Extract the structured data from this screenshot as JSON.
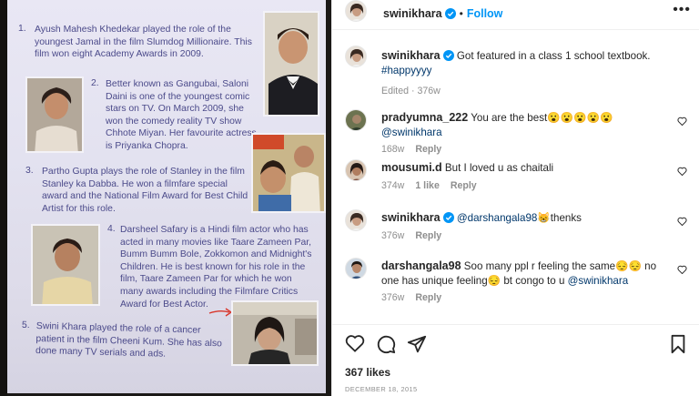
{
  "post": {
    "username": "swinikhara",
    "follow_label": "Follow",
    "caption": "Got featured in a class 1 school textbook.",
    "hashtag": "#happyyyy",
    "caption_meta": "Edited · 376w",
    "likes": "367 likes",
    "date": "DECEMBER 18, 2015"
  },
  "comments": [
    {
      "username": "pradyumna_222",
      "text": "You are the best",
      "emoji": "😮😮😮😮😮",
      "mention": "@swinikhara",
      "age": "168w",
      "likes": "",
      "reply": "Reply"
    },
    {
      "username": "mousumi.d",
      "text": "But I loved u as chaitali",
      "age": "374w",
      "likes": "1 like",
      "reply": "Reply"
    },
    {
      "username": "swinikhara",
      "mention": "@darshangala98",
      "emoji": "😸",
      "text": "thenks",
      "age": "376w",
      "reply": "Reply"
    },
    {
      "username": "darshangala98",
      "text_a": "Soo many ppl r feeling the same",
      "emoji_a": "😔😔",
      "text_b": "no one has unique feeling",
      "emoji_b": "😔",
      "text_c": "bt congo to u",
      "mention": "@swinikhara",
      "age": "376w",
      "reply": "Reply"
    }
  ],
  "textbook": {
    "item1_num": "1.",
    "item1": "Ayush Mahesh Khedekar played the role of the youngest Jamal in the film Slumdog Millionaire. This film won eight Academy Awards in 2009.",
    "item2_num": "2.",
    "item2": "Better known as Gangubai, Saloni Daini is one of the youngest comic stars on TV. On March 2009, she won the comedy reality TV show Chhote Miyan. Her favourite actress is Priyanka Chopra.",
    "item3_num": "3.",
    "item3": "Partho Gupta plays the role of Stanley in the film Stanley ka Dabba. He won a filmfare special award and the National Film Award for Best Child Artist for this role.",
    "item4_num": "4.",
    "item4": "Darsheel Safary is a Hindi film actor who has acted in many movies like Taare Zameen Par, Bumm Bumm Bole, Zokkomon and Midnight's Children. He is best known for his role in the film, Taare Zameen Par for which he won many awards including the Filmfare Critics Award for Best Actor.",
    "item5_num": "5.",
    "item5": "Swini Khara played the role of a cancer patient in the film Cheeni Kum. She has also done many TV serials and ads."
  },
  "icons": {
    "verified": "verified-badge-icon",
    "more": "more-options-icon",
    "heart": "heart-icon",
    "comment": "comment-icon",
    "share": "share-icon",
    "save": "bookmark-icon"
  },
  "colors": {
    "link_blue": "#0095f6",
    "mention": "#00376b",
    "muted": "#8e8e8e",
    "verified": "#0095f6"
  }
}
